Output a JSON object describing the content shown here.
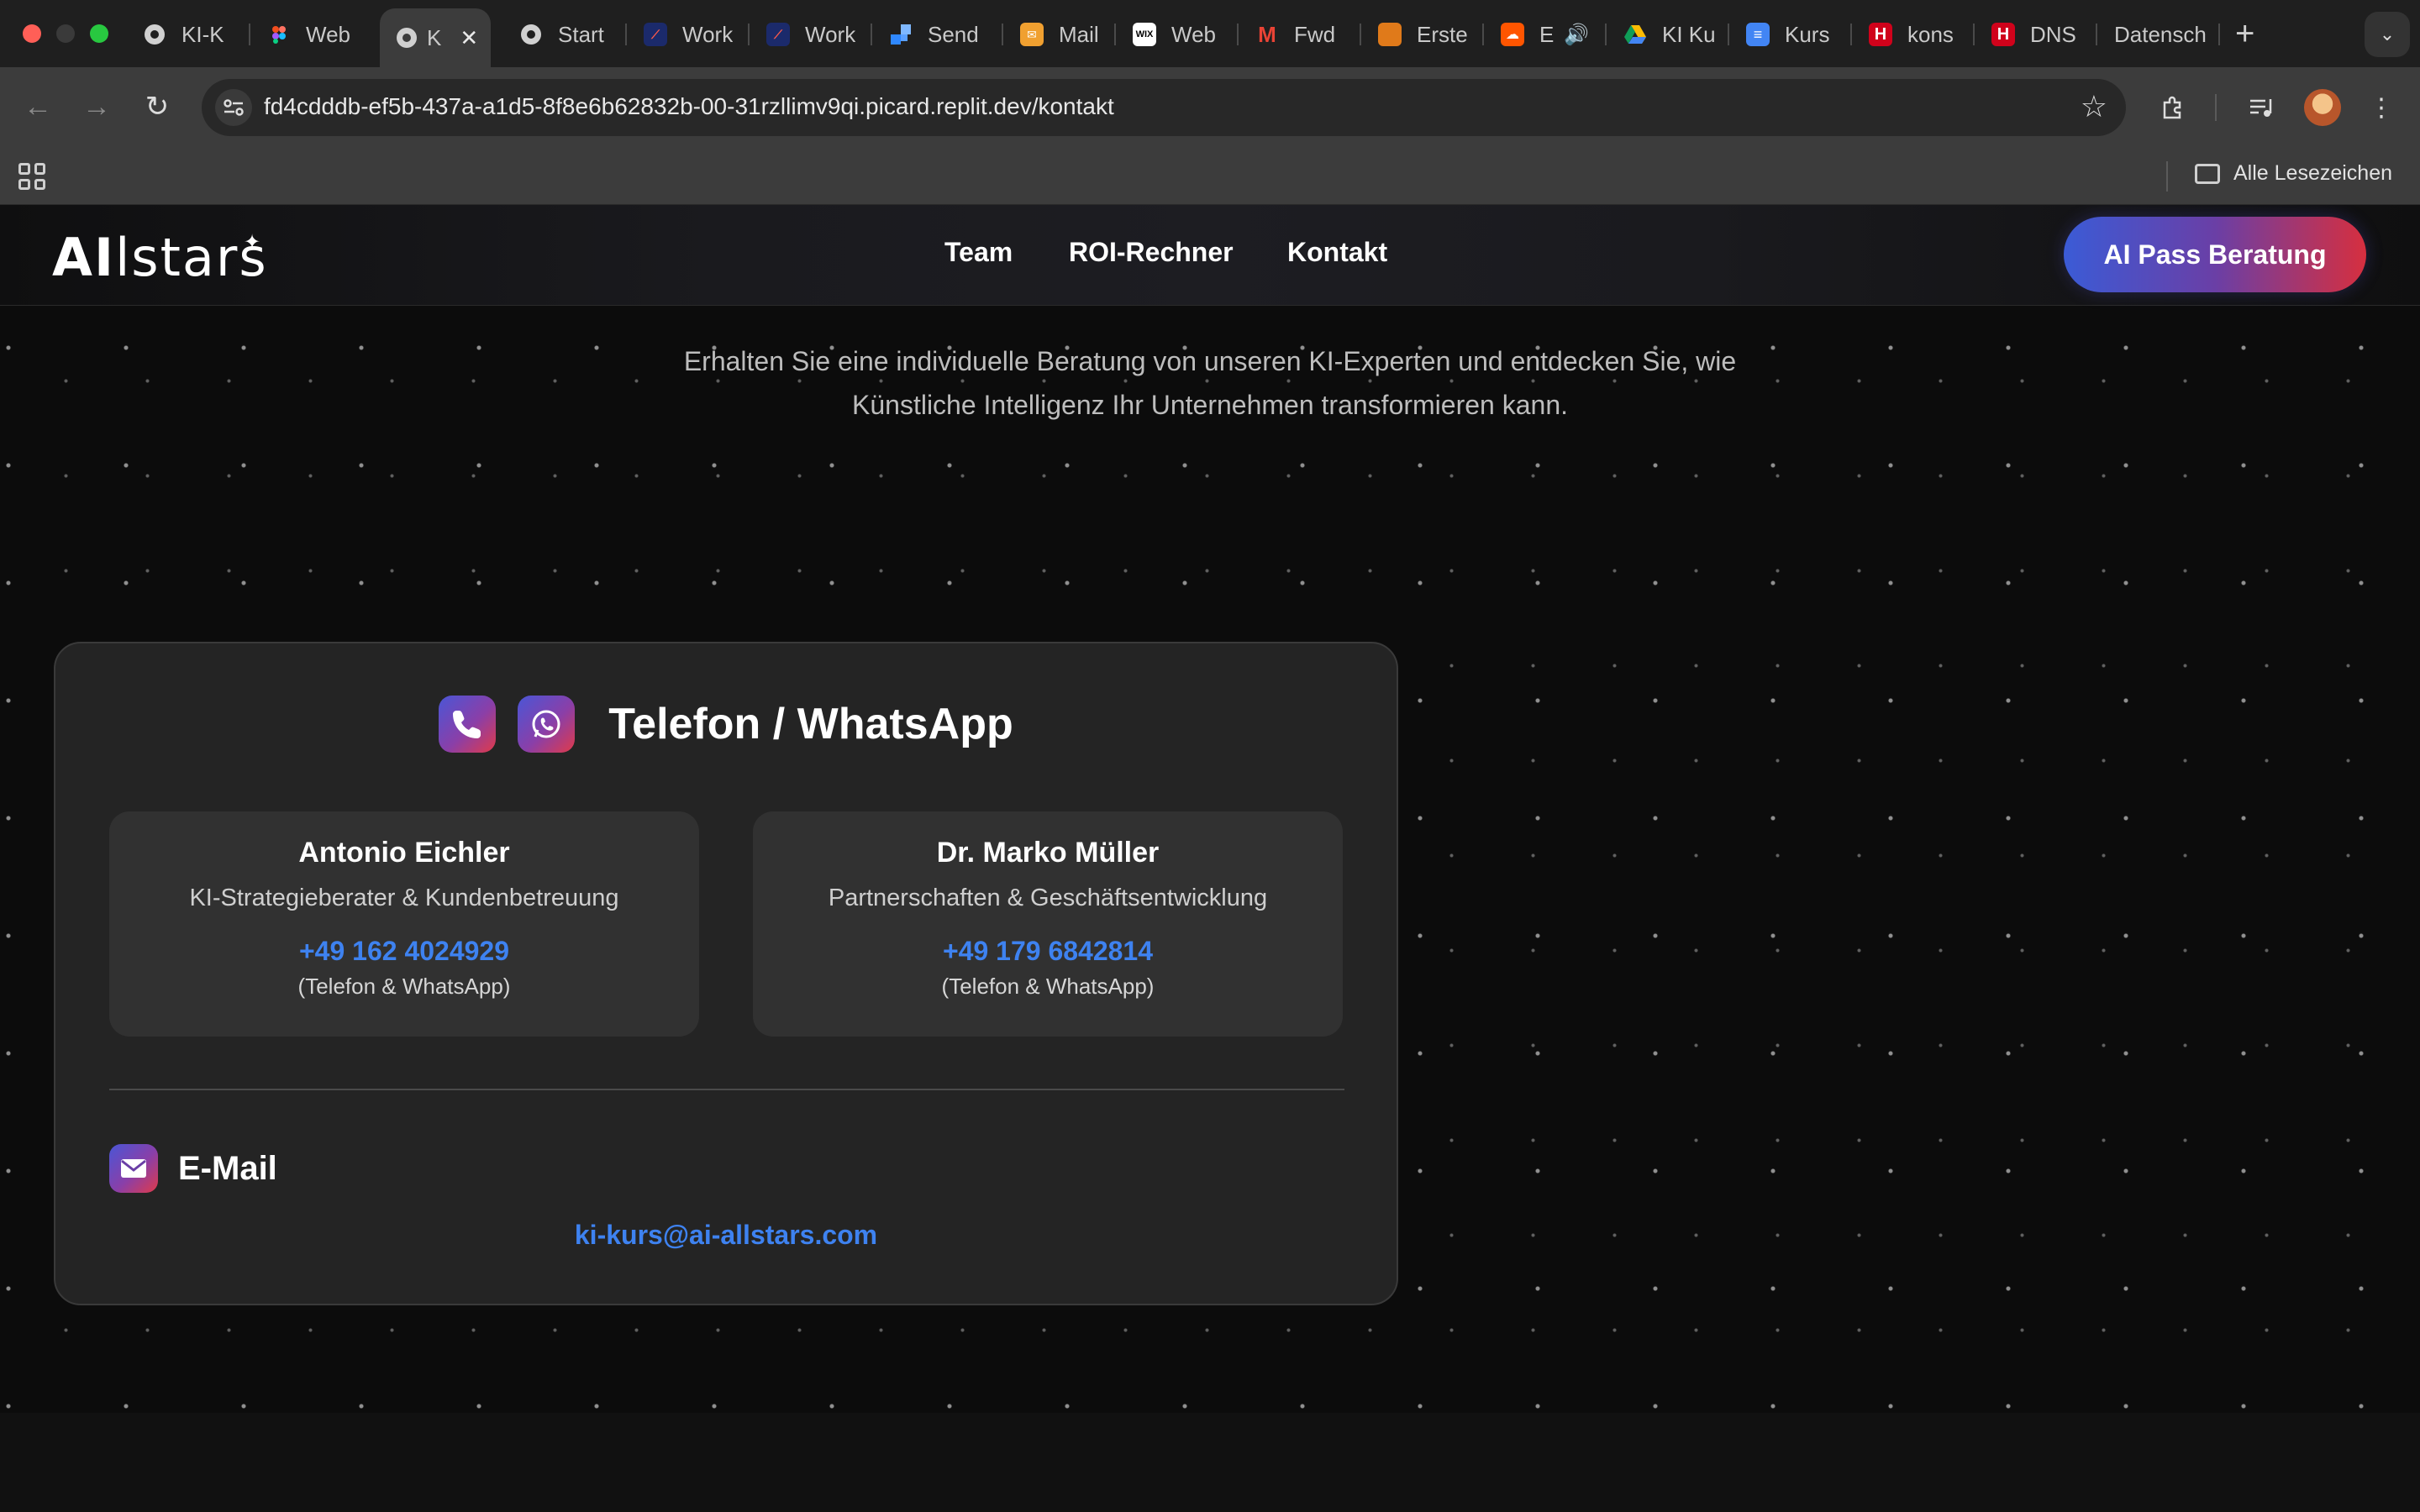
{
  "browser": {
    "tabs": [
      {
        "label": "KI-K",
        "favicon": "globe-icon"
      },
      {
        "label": "Web",
        "favicon": "figma-icon"
      },
      {
        "label": "K",
        "favicon": "globe-icon",
        "active": true
      },
      {
        "label": "Start",
        "favicon": "globe-icon"
      },
      {
        "label": "Work",
        "favicon": "workflow-icon"
      },
      {
        "label": "Work",
        "favicon": "workflow-icon"
      },
      {
        "label": "Send",
        "favicon": "sendinblue-icon"
      },
      {
        "label": "Mail",
        "favicon": "mail-icon"
      },
      {
        "label": "Web",
        "favicon": "wix-icon"
      },
      {
        "label": "Fwd",
        "favicon": "gmail-icon"
      },
      {
        "label": "Erste",
        "favicon": "doc-icon"
      },
      {
        "label": "E",
        "favicon": "soundcloud-icon"
      },
      {
        "label": "KI Ku",
        "favicon": "drive-icon"
      },
      {
        "label": "Kurs",
        "favicon": "gdocs-icon"
      },
      {
        "label": "kons",
        "favicon": "h-icon"
      },
      {
        "label": "DNS",
        "favicon": "h-icon"
      },
      {
        "label": "Datensch",
        "favicon": "none"
      }
    ],
    "url": "fd4cdddb-ef5b-437a-a1d5-8f8e6b62832b-00-31rzllimv9qi.picard.replit.dev/kontakt",
    "bookmarks_all": "Alle Lesezeichen"
  },
  "site": {
    "logo_ai": "AI",
    "logo_rest": "lstars",
    "nav": {
      "team": "Team",
      "roi": "ROI-Rechner",
      "kontakt": "Kontakt"
    },
    "cta": "AI Pass Beratung",
    "intro": "Erhalten Sie eine individuelle Beratung von unseren KI-Experten und entdecken Sie, wie Künstliche Intelligenz Ihr Unternehmen transformieren kann."
  },
  "contact_card": {
    "title": "Telefon / WhatsApp",
    "persons": [
      {
        "name": "Antonio Eichler",
        "role": "KI-Strategieberater & Kundenbetreuung",
        "phone": "+49 162 4024929",
        "note": "(Telefon & WhatsApp)"
      },
      {
        "name": "Dr. Marko Müller",
        "role": "Partnerschaften & Geschäftsentwicklung",
        "phone": "+49 179 6842814",
        "note": "(Telefon & WhatsApp)"
      }
    ],
    "email_title": "E-Mail",
    "email": "ki-kurs@ai-allstars.com"
  },
  "colors": {
    "accent_blue": "#3e82f0",
    "cta_start": "#3b5bd6",
    "cta_end": "#d62f3f"
  }
}
